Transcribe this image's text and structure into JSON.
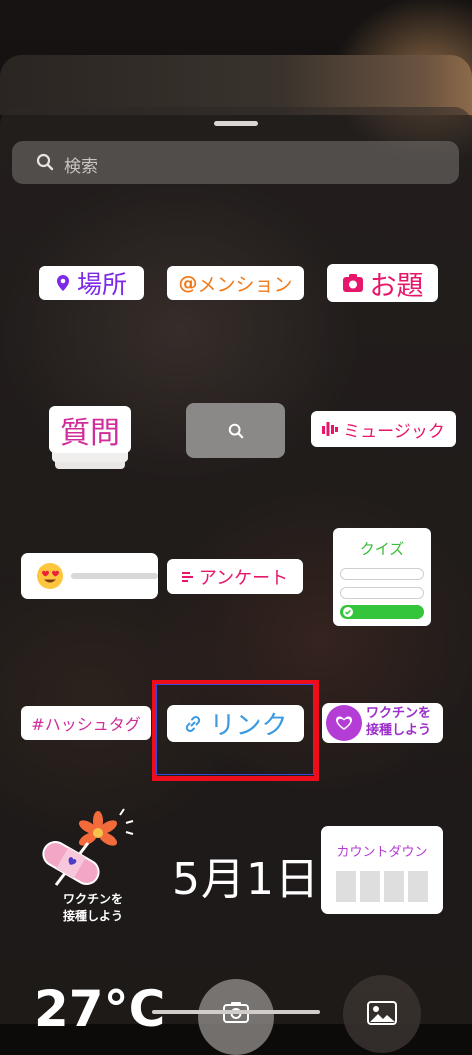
{
  "search": {
    "placeholder": "検索"
  },
  "stickers": {
    "location": "場所",
    "mention": "メンション",
    "mention_prefix": "@",
    "add_yours": "お題",
    "questions": "質問",
    "music": "ミュージック",
    "quiz": "クイズ",
    "poll": "アンケート",
    "hashtag": "#ハッシュタグ",
    "link": "リンク",
    "vaccine_line1": "ワクチンを",
    "vaccine_line2": "接種しよう",
    "vaccine_art_line1": "ワクチンを",
    "vaccine_art_line2": "接種しよう",
    "date": "5月1日",
    "countdown": "カウントダウン",
    "temperature": "27°C"
  },
  "colors": {
    "highlight": "#ee0d1b",
    "purple": "#7c2ae8",
    "pink": "#e6176b",
    "quiz_green": "#35c53d"
  }
}
